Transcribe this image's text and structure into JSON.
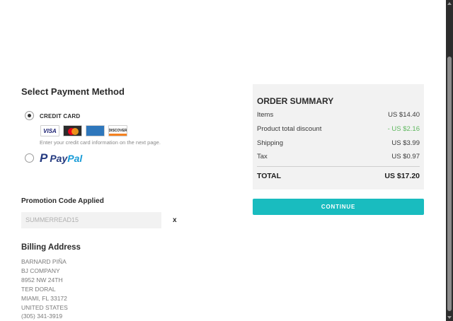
{
  "payment": {
    "title": "Select Payment Method",
    "credit_card_label": "CREDIT CARD",
    "credit_card_note": "Enter your credit card information on the next page.",
    "cards": {
      "visa": "VISA",
      "mastercard": "MasterCard",
      "amex": "AMERICAN EXPRESS",
      "discover": "DISCOVER"
    },
    "paypal_pay": "Pay",
    "paypal_pal": "Pal",
    "selected": "credit_card"
  },
  "promo": {
    "title": "Promotion Code Applied",
    "code": "SUMMERREAD15",
    "remove_label": "x"
  },
  "billing": {
    "title": "Billing Address",
    "lines": [
      "BARNARD PIÑA",
      "BJ COMPANY",
      "8952 NW 24TH",
      "TER DORAL",
      "MIAMI, FL 33172",
      "UNITED STATES",
      "(305) 341-3919"
    ]
  },
  "summary": {
    "title": "ORDER SUMMARY",
    "rows": [
      {
        "label": "Items",
        "value": "US $14.40"
      },
      {
        "label": "Product total discount",
        "value": "- US $2.16"
      },
      {
        "label": "Shipping",
        "value": "US $3.99"
      },
      {
        "label": "Tax",
        "value": "US $0.97"
      }
    ],
    "total_label": "TOTAL",
    "total_value": "US $17.20"
  },
  "continue_label": "CONTINUE",
  "colors": {
    "accent": "#19bcbf",
    "discount": "#5fb85f",
    "summary_bg": "#f2f2f2"
  }
}
